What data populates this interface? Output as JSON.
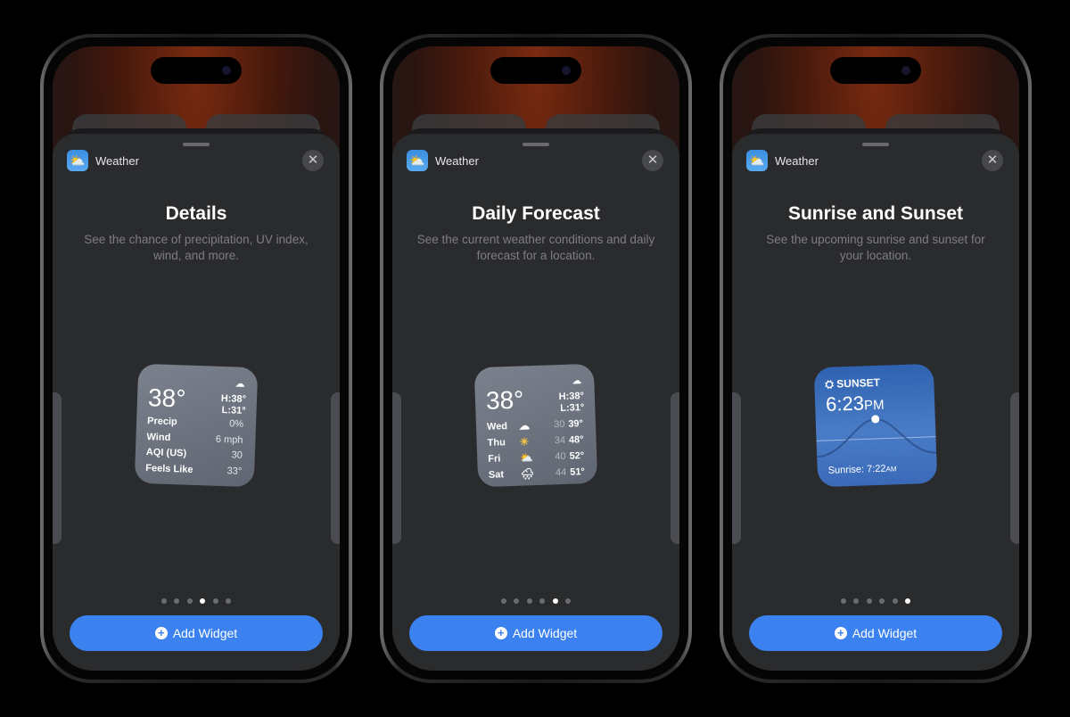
{
  "phones": [
    {
      "app_name": "Weather",
      "title": "Details",
      "description": "See the chance of precipitation, UV index, wind, and more.",
      "active_page": 4,
      "page_count": 6,
      "add_label": "Add Widget",
      "widget": {
        "type": "details",
        "temp": "38°",
        "high": "H:38°",
        "low": "L:31°",
        "rows": [
          {
            "label": "Precip",
            "value": "0%"
          },
          {
            "label": "Wind",
            "value": "6 mph"
          },
          {
            "label": "AQI (US)",
            "value": "30"
          },
          {
            "label": "Feels Like",
            "value": "33°"
          }
        ]
      }
    },
    {
      "app_name": "Weather",
      "title": "Daily Forecast",
      "description": "See the current weather conditions and daily forecast for a location.",
      "active_page": 5,
      "page_count": 6,
      "add_label": "Add Widget",
      "widget": {
        "type": "daily",
        "temp": "38°",
        "high": "H:38°",
        "low": "L:31°",
        "days": [
          {
            "day": "Wed",
            "icon": "cloud",
            "low": "30",
            "high": "39°"
          },
          {
            "day": "Thu",
            "icon": "sun",
            "low": "34",
            "high": "48°"
          },
          {
            "day": "Fri",
            "icon": "partly-cloudy",
            "low": "40",
            "high": "52°"
          },
          {
            "day": "Sat",
            "icon": "rain",
            "low": "44",
            "high": "51°"
          }
        ]
      }
    },
    {
      "app_name": "Weather",
      "title": "Sunrise and Sunset",
      "description": "See the upcoming sunrise and sunset for your location.",
      "active_page": 6,
      "page_count": 6,
      "add_label": "Add Widget",
      "widget": {
        "type": "sunset",
        "label": "SUNSET",
        "time": "6:23",
        "ampm": "PM",
        "sunrise_label": "Sunrise: 7:22",
        "sunrise_ampm": "AM"
      }
    }
  ],
  "colors": {
    "accent": "#3b82f0",
    "sheet": "#2a2b2d"
  }
}
